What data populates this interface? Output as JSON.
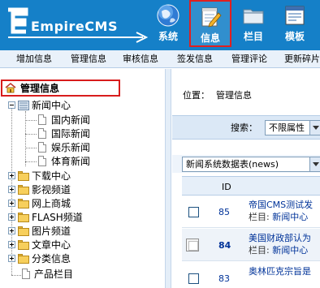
{
  "header": {
    "logo_text": "EmpireCMS",
    "nav": [
      {
        "label": "系统",
        "icon": "globe-icon"
      },
      {
        "label": "信息",
        "icon": "notepad-edit-icon"
      },
      {
        "label": "栏目",
        "icon": "folder-icon"
      },
      {
        "label": "模板",
        "icon": "window-template-icon"
      }
    ]
  },
  "subnav": {
    "items": [
      "增加信息",
      "管理信息",
      "审核信息",
      "签发信息",
      "管理评论",
      "更新碎片"
    ]
  },
  "tree": {
    "title": "管理信息",
    "nodes": [
      {
        "label": "新闻中心",
        "expanded": true,
        "children": [
          "国内新闻",
          "国际新闻",
          "娱乐新闻",
          "体育新闻"
        ]
      },
      {
        "label": "下载中心"
      },
      {
        "label": "影视频道"
      },
      {
        "label": "网上商城"
      },
      {
        "label": "FLASH频道"
      },
      {
        "label": "图片频道"
      },
      {
        "label": "文章中心"
      },
      {
        "label": "分类信息"
      },
      {
        "label": "产品栏目"
      }
    ]
  },
  "main": {
    "position_label": "位置：",
    "position_value": "管理信息",
    "search_label": "搜索：",
    "search_select": "不限属性",
    "table_select": "新闻系统数据表(news)",
    "columns": {
      "id": "ID"
    },
    "rows": [
      {
        "id": "85",
        "title": "帝国CMS测试发",
        "meta_label": "栏目: ",
        "meta_value": "新闻中心"
      },
      {
        "id": "84",
        "title": "美国财政部认为",
        "meta_label": "栏目: ",
        "meta_value": "新闻中心"
      },
      {
        "id": "83",
        "title": "奥林匹克宗旨是",
        "meta_label": "",
        "meta_value": ""
      }
    ]
  },
  "colors": {
    "header_blue": "#1580c8",
    "highlight_red": "#d81c1c",
    "link_blue": "#003399",
    "subnav_bg": "#e9f1fa"
  }
}
